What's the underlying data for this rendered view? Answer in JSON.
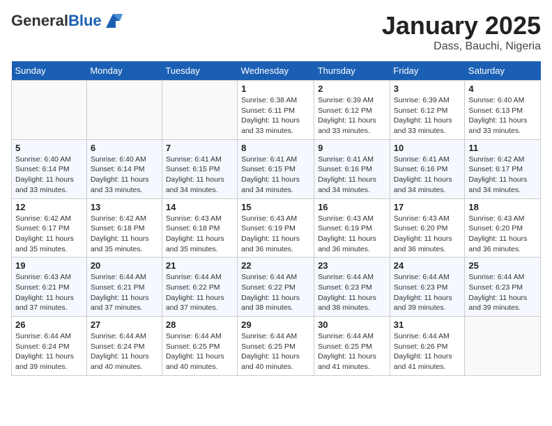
{
  "header": {
    "logo_general": "General",
    "logo_blue": "Blue",
    "title": "January 2025",
    "subtitle": "Dass, Bauchi, Nigeria"
  },
  "weekdays": [
    "Sunday",
    "Monday",
    "Tuesday",
    "Wednesday",
    "Thursday",
    "Friday",
    "Saturday"
  ],
  "weeks": [
    [
      {
        "day": "",
        "info": ""
      },
      {
        "day": "",
        "info": ""
      },
      {
        "day": "",
        "info": ""
      },
      {
        "day": "1",
        "info": "Sunrise: 6:38 AM\nSunset: 6:11 PM\nDaylight: 11 hours and 33 minutes."
      },
      {
        "day": "2",
        "info": "Sunrise: 6:39 AM\nSunset: 6:12 PM\nDaylight: 11 hours and 33 minutes."
      },
      {
        "day": "3",
        "info": "Sunrise: 6:39 AM\nSunset: 6:12 PM\nDaylight: 11 hours and 33 minutes."
      },
      {
        "day": "4",
        "info": "Sunrise: 6:40 AM\nSunset: 6:13 PM\nDaylight: 11 hours and 33 minutes."
      }
    ],
    [
      {
        "day": "5",
        "info": "Sunrise: 6:40 AM\nSunset: 6:14 PM\nDaylight: 11 hours and 33 minutes."
      },
      {
        "day": "6",
        "info": "Sunrise: 6:40 AM\nSunset: 6:14 PM\nDaylight: 11 hours and 33 minutes."
      },
      {
        "day": "7",
        "info": "Sunrise: 6:41 AM\nSunset: 6:15 PM\nDaylight: 11 hours and 34 minutes."
      },
      {
        "day": "8",
        "info": "Sunrise: 6:41 AM\nSunset: 6:15 PM\nDaylight: 11 hours and 34 minutes."
      },
      {
        "day": "9",
        "info": "Sunrise: 6:41 AM\nSunset: 6:16 PM\nDaylight: 11 hours and 34 minutes."
      },
      {
        "day": "10",
        "info": "Sunrise: 6:41 AM\nSunset: 6:16 PM\nDaylight: 11 hours and 34 minutes."
      },
      {
        "day": "11",
        "info": "Sunrise: 6:42 AM\nSunset: 6:17 PM\nDaylight: 11 hours and 34 minutes."
      }
    ],
    [
      {
        "day": "12",
        "info": "Sunrise: 6:42 AM\nSunset: 6:17 PM\nDaylight: 11 hours and 35 minutes."
      },
      {
        "day": "13",
        "info": "Sunrise: 6:42 AM\nSunset: 6:18 PM\nDaylight: 11 hours and 35 minutes."
      },
      {
        "day": "14",
        "info": "Sunrise: 6:43 AM\nSunset: 6:18 PM\nDaylight: 11 hours and 35 minutes."
      },
      {
        "day": "15",
        "info": "Sunrise: 6:43 AM\nSunset: 6:19 PM\nDaylight: 11 hours and 36 minutes."
      },
      {
        "day": "16",
        "info": "Sunrise: 6:43 AM\nSunset: 6:19 PM\nDaylight: 11 hours and 36 minutes."
      },
      {
        "day": "17",
        "info": "Sunrise: 6:43 AM\nSunset: 6:20 PM\nDaylight: 11 hours and 36 minutes."
      },
      {
        "day": "18",
        "info": "Sunrise: 6:43 AM\nSunset: 6:20 PM\nDaylight: 11 hours and 36 minutes."
      }
    ],
    [
      {
        "day": "19",
        "info": "Sunrise: 6:43 AM\nSunset: 6:21 PM\nDaylight: 11 hours and 37 minutes."
      },
      {
        "day": "20",
        "info": "Sunrise: 6:44 AM\nSunset: 6:21 PM\nDaylight: 11 hours and 37 minutes."
      },
      {
        "day": "21",
        "info": "Sunrise: 6:44 AM\nSunset: 6:22 PM\nDaylight: 11 hours and 37 minutes."
      },
      {
        "day": "22",
        "info": "Sunrise: 6:44 AM\nSunset: 6:22 PM\nDaylight: 11 hours and 38 minutes."
      },
      {
        "day": "23",
        "info": "Sunrise: 6:44 AM\nSunset: 6:23 PM\nDaylight: 11 hours and 38 minutes."
      },
      {
        "day": "24",
        "info": "Sunrise: 6:44 AM\nSunset: 6:23 PM\nDaylight: 11 hours and 39 minutes."
      },
      {
        "day": "25",
        "info": "Sunrise: 6:44 AM\nSunset: 6:23 PM\nDaylight: 11 hours and 39 minutes."
      }
    ],
    [
      {
        "day": "26",
        "info": "Sunrise: 6:44 AM\nSunset: 6:24 PM\nDaylight: 11 hours and 39 minutes."
      },
      {
        "day": "27",
        "info": "Sunrise: 6:44 AM\nSunset: 6:24 PM\nDaylight: 11 hours and 40 minutes."
      },
      {
        "day": "28",
        "info": "Sunrise: 6:44 AM\nSunset: 6:25 PM\nDaylight: 11 hours and 40 minutes."
      },
      {
        "day": "29",
        "info": "Sunrise: 6:44 AM\nSunset: 6:25 PM\nDaylight: 11 hours and 40 minutes."
      },
      {
        "day": "30",
        "info": "Sunrise: 6:44 AM\nSunset: 6:25 PM\nDaylight: 11 hours and 41 minutes."
      },
      {
        "day": "31",
        "info": "Sunrise: 6:44 AM\nSunset: 6:26 PM\nDaylight: 11 hours and 41 minutes."
      },
      {
        "day": "",
        "info": ""
      }
    ]
  ]
}
